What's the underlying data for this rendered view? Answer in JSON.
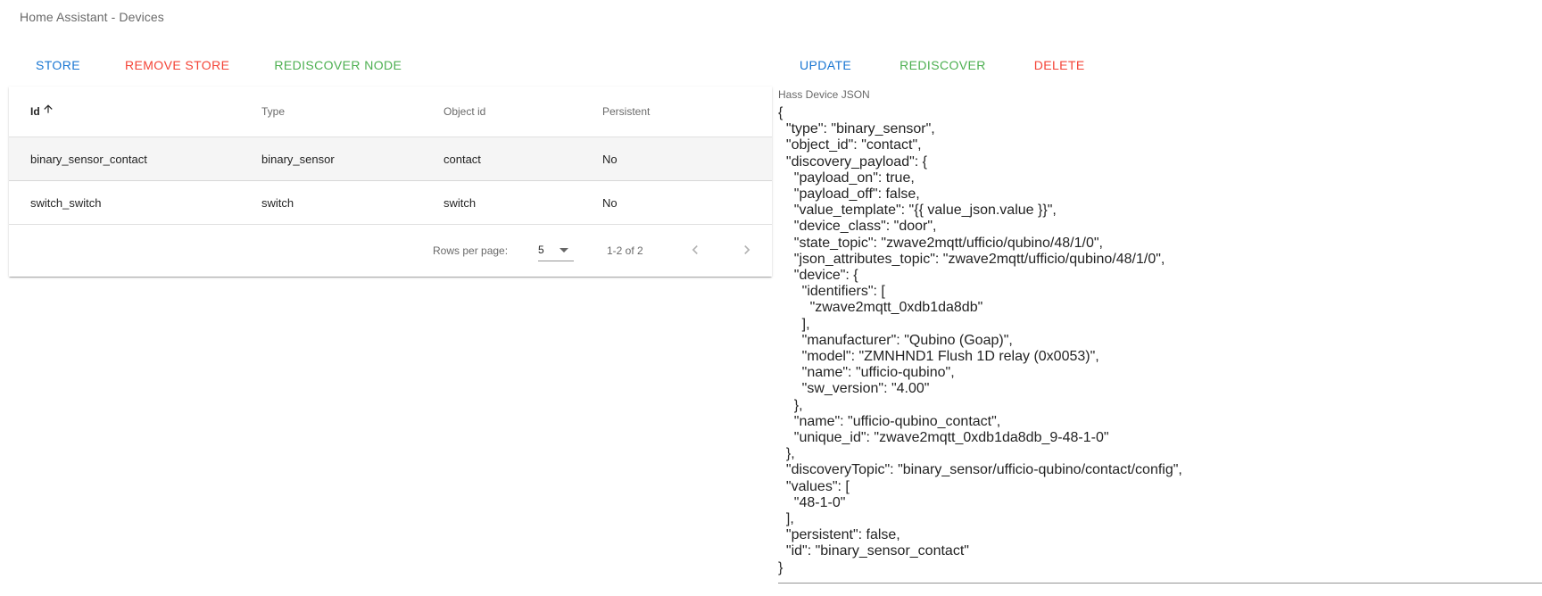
{
  "window": {
    "title": "Home Assistant - Devices"
  },
  "toolbar_left": {
    "store": "STORE",
    "remove_store": "REMOVE STORE",
    "rediscover_node": "REDISCOVER NODE"
  },
  "toolbar_right": {
    "update": "UPDATE",
    "rediscover": "REDISCOVER",
    "delete": "DELETE"
  },
  "table": {
    "headers": {
      "id": "Id",
      "type": "Type",
      "object_id": "Object id",
      "persistent": "Persistent"
    },
    "sort": {
      "column": "Id",
      "direction": "ascending",
      "icon": "arrow-up-icon"
    },
    "rows": [
      {
        "id": "binary_sensor_contact",
        "type": "binary_sensor",
        "object_id": "contact",
        "persistent": "No",
        "selected": true
      },
      {
        "id": "switch_switch",
        "type": "switch",
        "object_id": "switch",
        "persistent": "No",
        "selected": false
      }
    ],
    "footer": {
      "rows_per_page_label": "Rows per page:",
      "rows_per_page_value": "5",
      "page_info": "1-2 of 2",
      "prev_icon": "chevron-left-icon",
      "next_icon": "chevron-right-icon"
    }
  },
  "json_panel": {
    "label": "Hass Device JSON",
    "content": "{\n  \"type\": \"binary_sensor\",\n  \"object_id\": \"contact\",\n  \"discovery_payload\": {\n    \"payload_on\": true,\n    \"payload_off\": false,\n    \"value_template\": \"{{ value_json.value }}\",\n    \"device_class\": \"door\",\n    \"state_topic\": \"zwave2mqtt/ufficio/qubino/48/1/0\",\n    \"json_attributes_topic\": \"zwave2mqtt/ufficio/qubino/48/1/0\",\n    \"device\": {\n      \"identifiers\": [\n        \"zwave2mqtt_0xdb1da8db\"\n      ],\n      \"manufacturer\": \"Qubino (Goap)\",\n      \"model\": \"ZMNHND1 Flush 1D relay (0x0053)\",\n      \"name\": \"ufficio-qubino\",\n      \"sw_version\": \"4.00\"\n    },\n    \"name\": \"ufficio-qubino_contact\",\n    \"unique_id\": \"zwave2mqtt_0xdb1da8db_9-48-1-0\"\n  },\n  \"discoveryTopic\": \"binary_sensor/ufficio-qubino/contact/config\",\n  \"values\": [\n    \"48-1-0\"\n  ],\n  \"persistent\": false,\n  \"id\": \"binary_sensor_contact\"\n}"
  },
  "colors": {
    "primary_blue": "#1976d2",
    "error_red": "#f44336",
    "success_green": "#4caf50",
    "selected_row": "#f5f5f5"
  }
}
